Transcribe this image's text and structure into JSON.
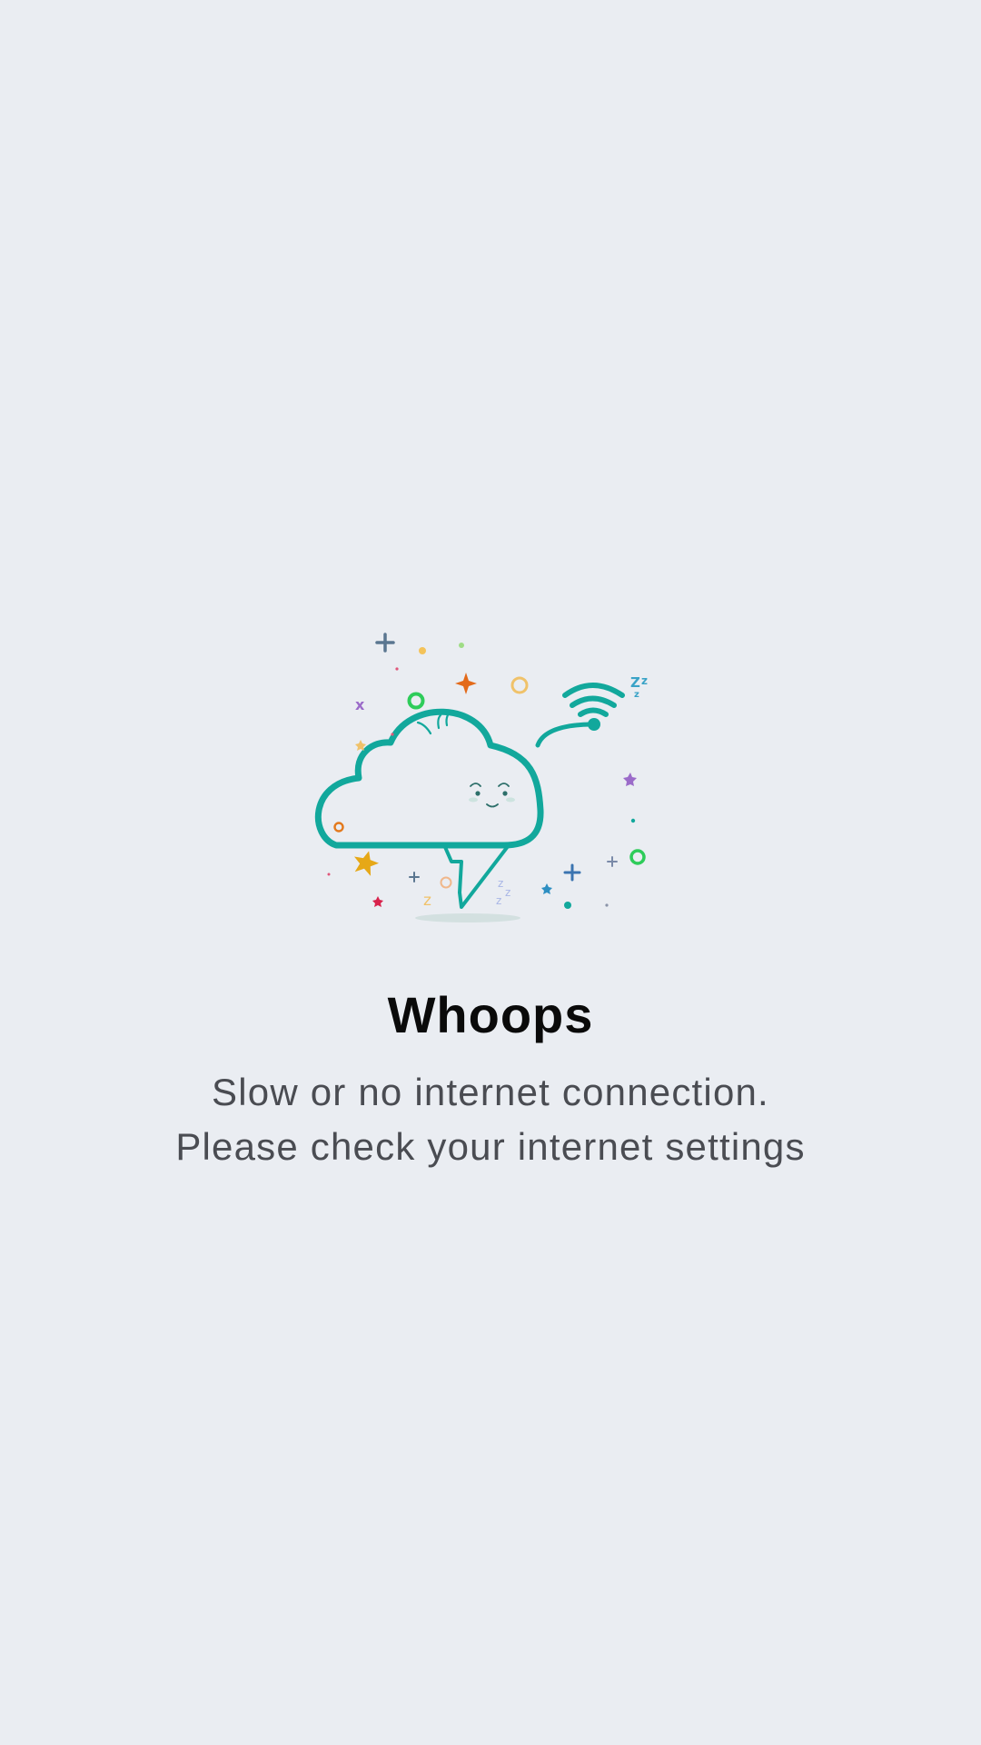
{
  "error_screen": {
    "title": "Whoops",
    "message_line_1": "Slow or no internet connection.",
    "message_line_2": "Please check your internet settings",
    "illustration": {
      "icon": "sleepy-cloud-lightning-wifi-icon",
      "snore_text": "Zz",
      "accent_color": "#12a89c"
    }
  },
  "colors": {
    "background": "#eaedf2",
    "title": "#0a0a0a",
    "message": "#4a4c52"
  }
}
